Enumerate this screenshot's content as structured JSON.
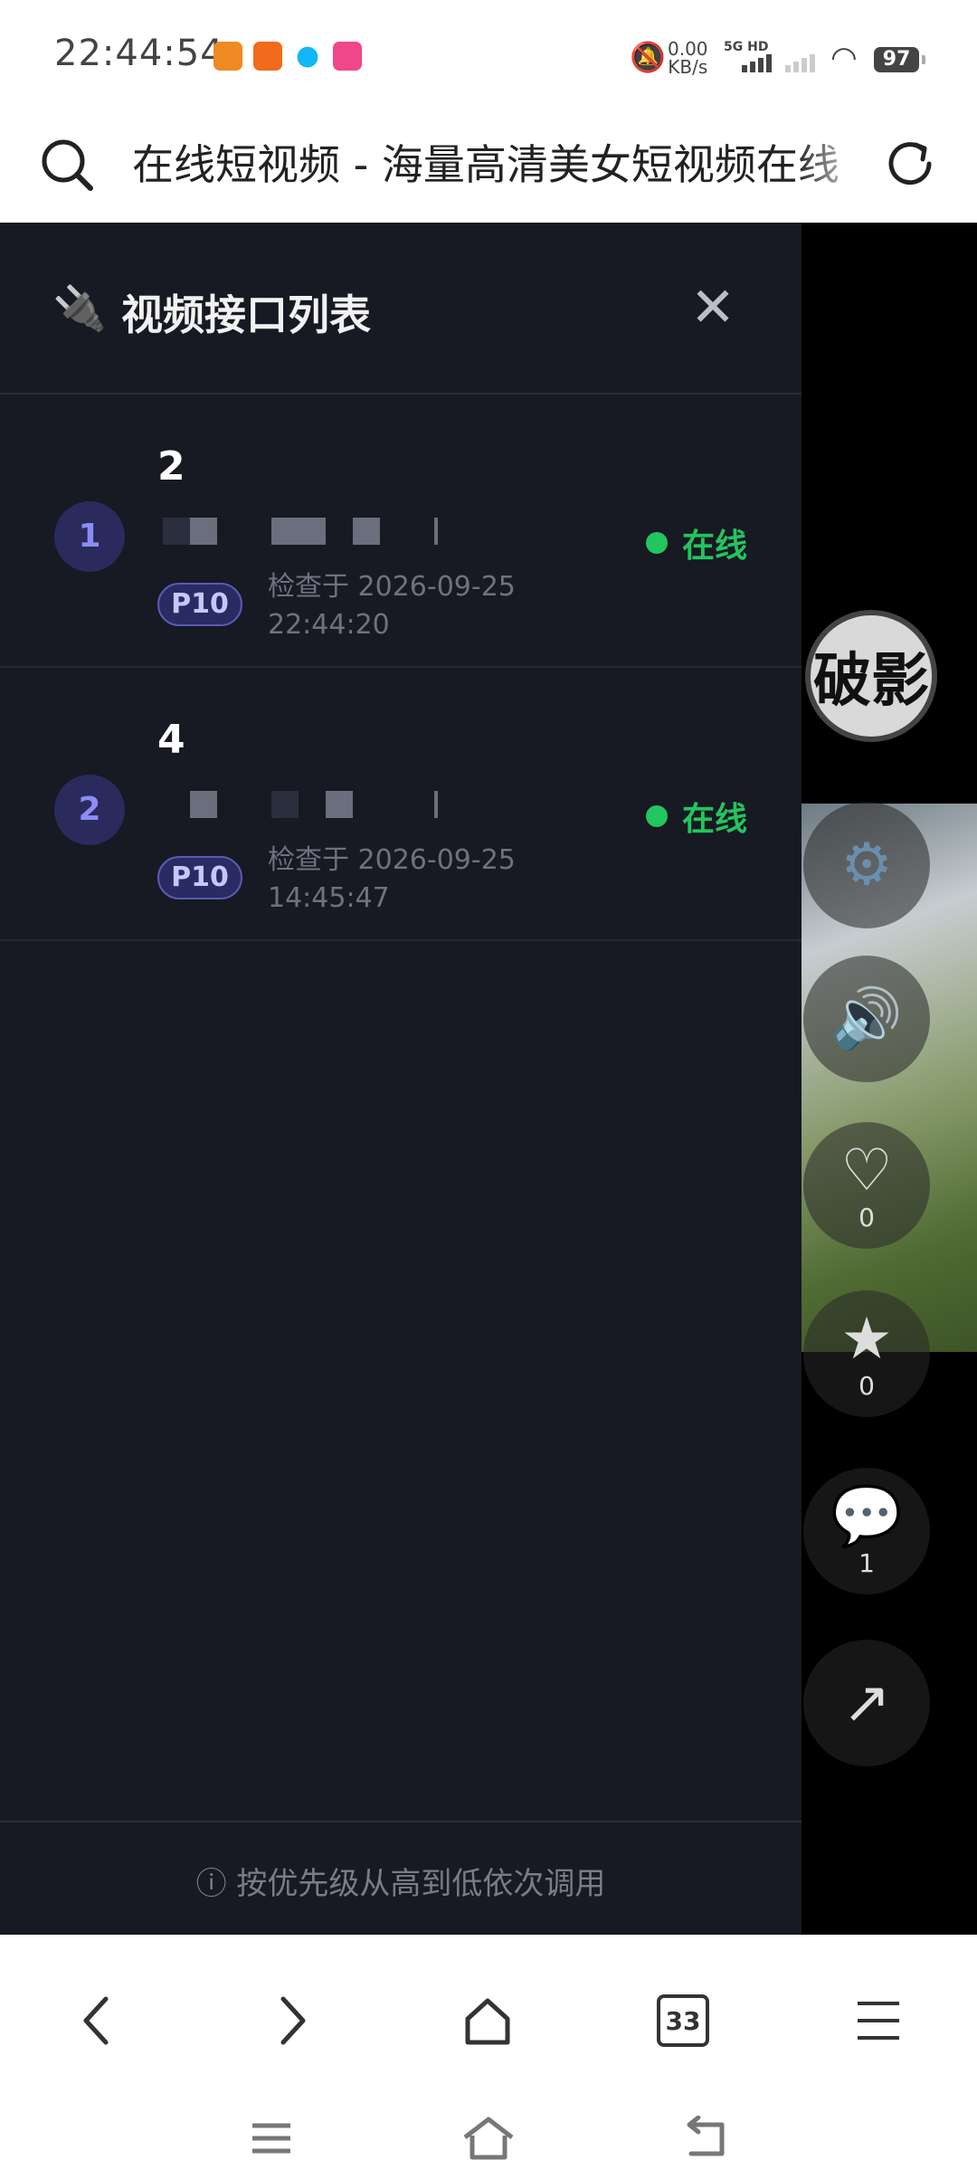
{
  "status_bar": {
    "time": "22:44:54",
    "net_speed_value": "0.00",
    "net_speed_unit": "KB/s",
    "network_type": "5G HD",
    "battery": "97"
  },
  "url_bar": {
    "page_title": "在线短视频 - 海量高清美女短视频在线"
  },
  "drawer": {
    "title": "视频接口列表",
    "items": [
      {
        "index": "1",
        "name": "2",
        "priority": "P10",
        "checked_text": "检查于 2026-09-25\n22:44:20",
        "status": "在线"
      },
      {
        "index": "2",
        "name": "4",
        "priority": "P10",
        "checked_text": "检查于 2026-09-25\n14:45:47",
        "status": "在线"
      }
    ],
    "footer_hint": "ⓘ 按优先级从高到低依次调用"
  },
  "video_side": {
    "logo_text": "破影",
    "like_count": "0",
    "favorite_count": "0",
    "comment_count": "1"
  },
  "bottom_bar": {
    "tabs_count": "33"
  },
  "colors": {
    "drawer_bg": "#171923",
    "online_green": "#22c55e",
    "badge_purple": "#2b2b63",
    "index_purple": "#8c8cf5"
  }
}
